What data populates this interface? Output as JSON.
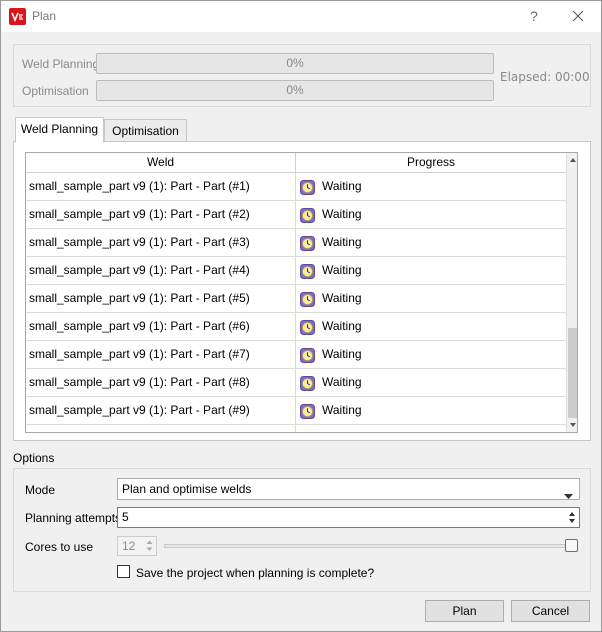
{
  "window": {
    "title": "Plan",
    "help_label": "?"
  },
  "progress": {
    "weld_planning_label": "Weld Planning",
    "weld_planning_value": "0%",
    "weld_planning_fraction": 0,
    "optimisation_label": "Optimisation",
    "optimisation_value": "0%",
    "optimisation_fraction": 0,
    "elapsed": "Elapsed: 00:00"
  },
  "tabs": [
    {
      "label": "Weld Planning",
      "active": true
    },
    {
      "label": "Optimisation",
      "active": false
    }
  ],
  "table": {
    "headers": [
      "Weld",
      "Progress"
    ],
    "status_icon": "clock-icon",
    "rows": [
      {
        "weld": "small_sample_part v9 (1): Part - Part (#1)",
        "status": "Waiting"
      },
      {
        "weld": "small_sample_part v9 (1): Part - Part (#2)",
        "status": "Waiting"
      },
      {
        "weld": "small_sample_part v9 (1): Part - Part (#3)",
        "status": "Waiting"
      },
      {
        "weld": "small_sample_part v9 (1): Part - Part (#4)",
        "status": "Waiting"
      },
      {
        "weld": "small_sample_part v9 (1): Part - Part (#5)",
        "status": "Waiting"
      },
      {
        "weld": "small_sample_part v9 (1): Part - Part (#6)",
        "status": "Waiting"
      },
      {
        "weld": "small_sample_part v9 (1): Part - Part (#7)",
        "status": "Waiting"
      },
      {
        "weld": "small_sample_part v9 (1): Part - Part (#8)",
        "status": "Waiting"
      },
      {
        "weld": "small_sample_part v9 (1): Part - Part (#9)",
        "status": "Waiting"
      }
    ]
  },
  "options": {
    "group_label": "Options",
    "mode_label": "Mode",
    "mode_value": "Plan and optimise welds",
    "attempts_label": "Planning attempts",
    "attempts_value": "5",
    "cores_label": "Cores to use",
    "cores_value": "12",
    "save_label": "Save the project when planning is complete?",
    "save_checked": false
  },
  "buttons": {
    "plan": "Plan",
    "cancel": "Cancel"
  },
  "colors": {
    "accent": "#d9141c"
  }
}
